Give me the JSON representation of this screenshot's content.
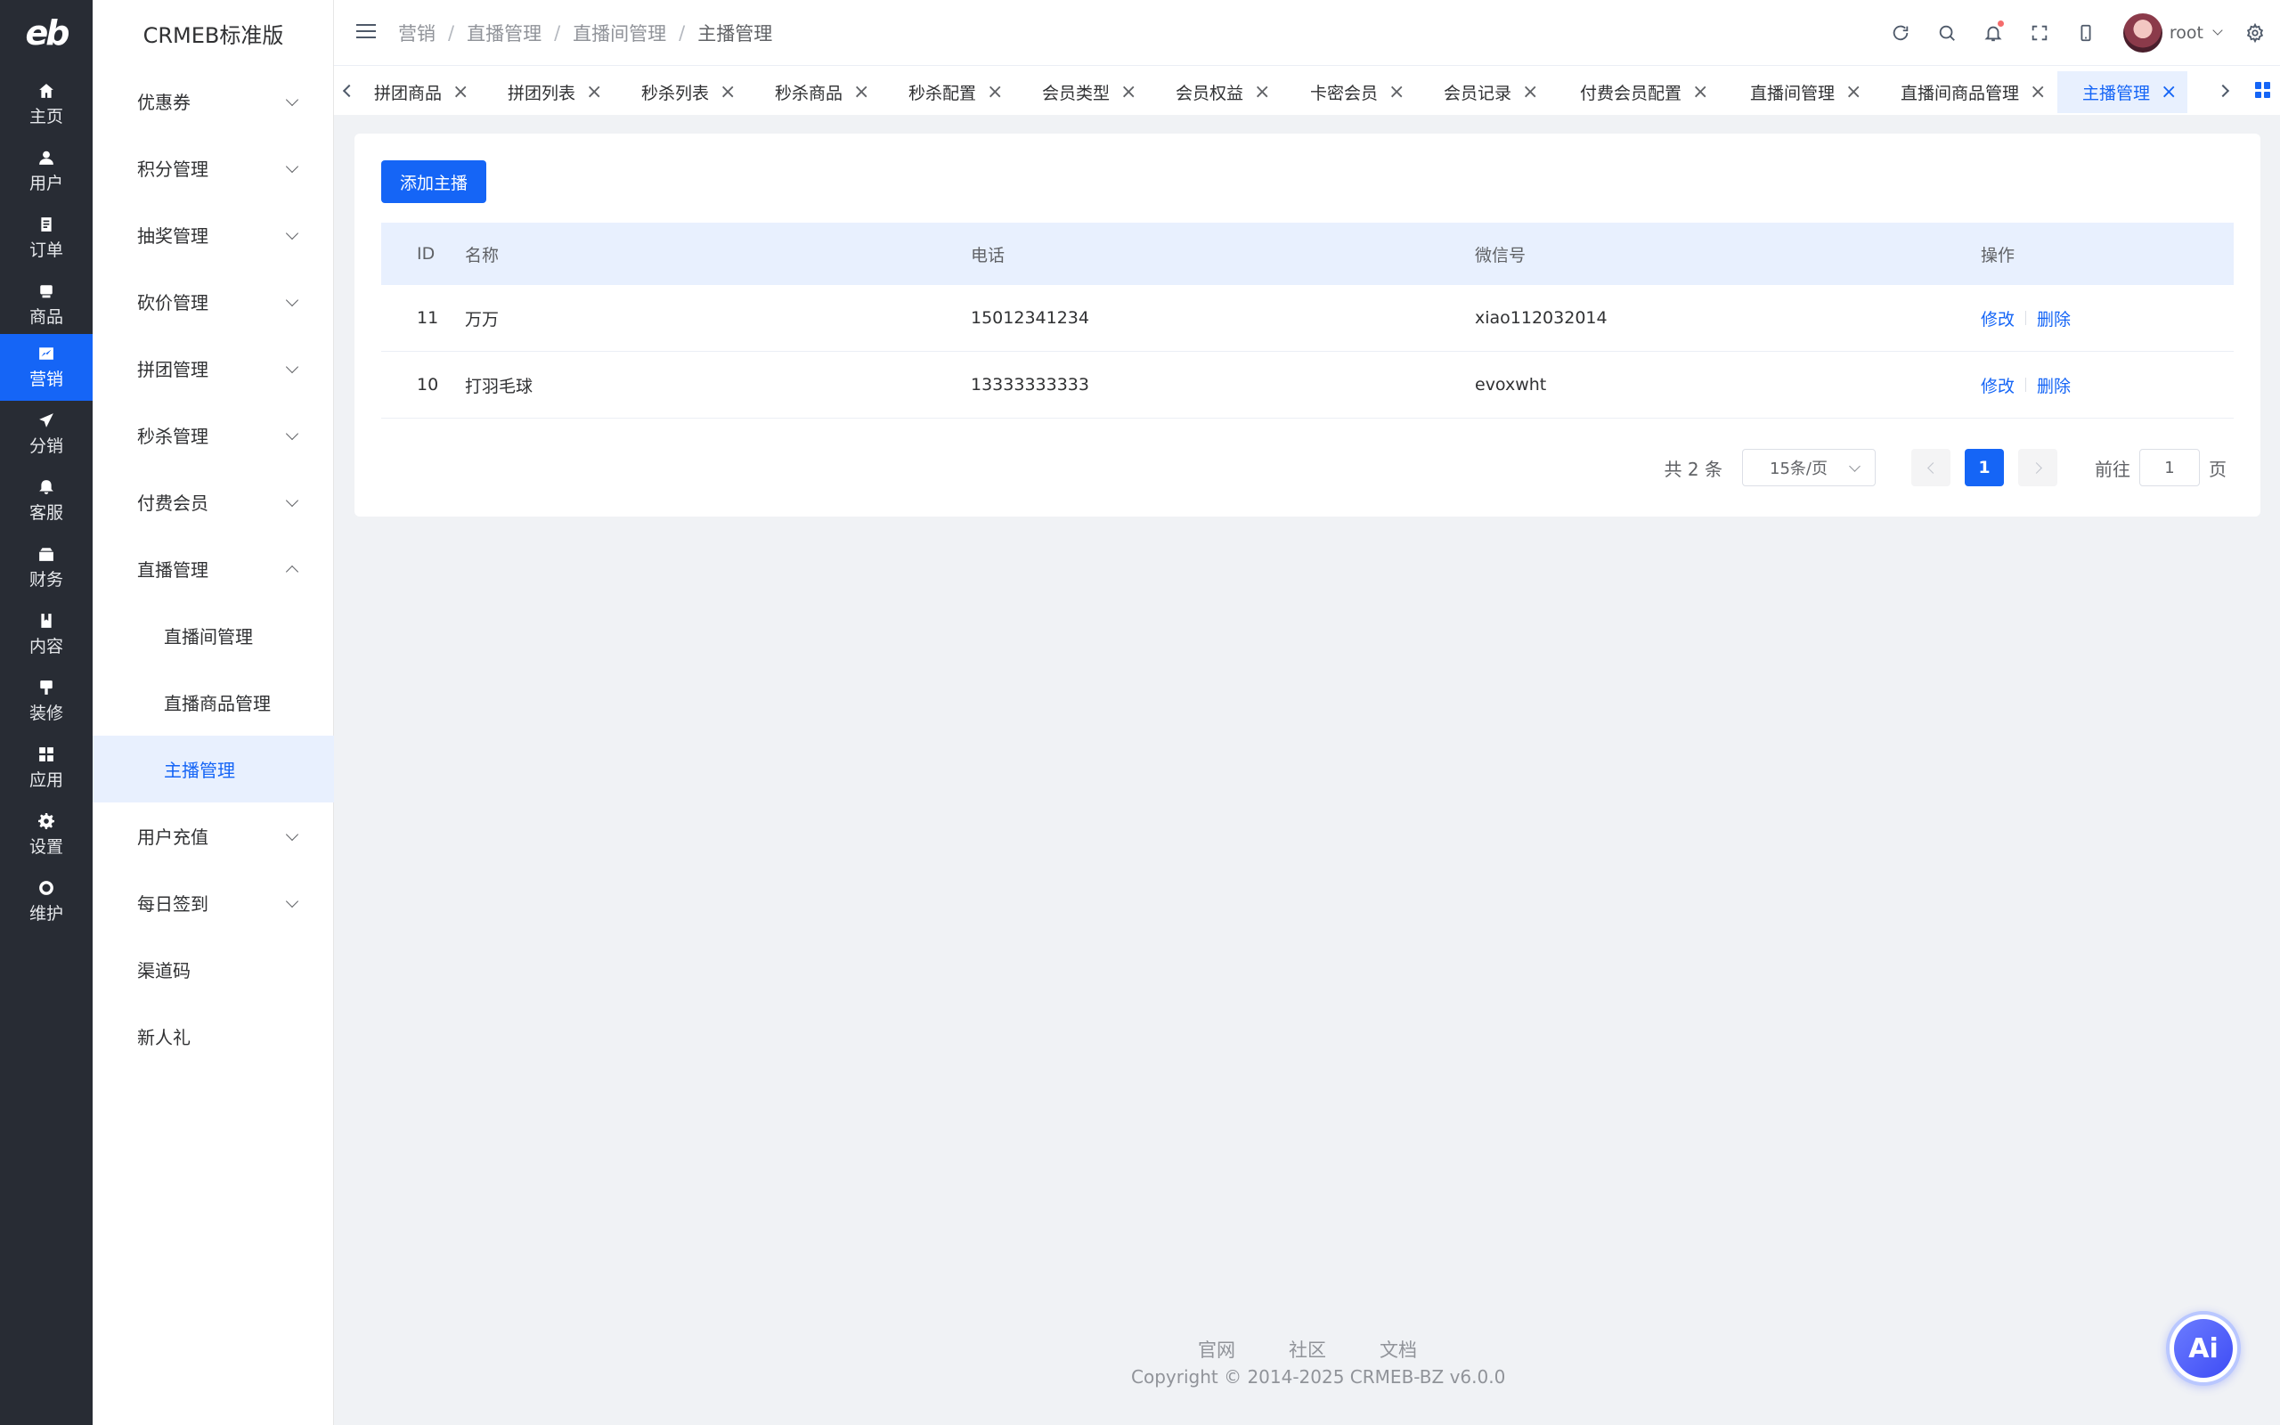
{
  "logo": "eb",
  "rail": [
    {
      "icon": "home-icon",
      "label": "主页"
    },
    {
      "icon": "user-icon",
      "label": "用户"
    },
    {
      "icon": "order-icon",
      "label": "订单"
    },
    {
      "icon": "goods-icon",
      "label": "商品"
    },
    {
      "icon": "marketing-icon",
      "label": "营销",
      "active": true
    },
    {
      "icon": "send-icon",
      "label": "分销"
    },
    {
      "icon": "bell-icon",
      "label": "客服"
    },
    {
      "icon": "finance-icon",
      "label": "财务"
    },
    {
      "icon": "book-icon",
      "label": "内容"
    },
    {
      "icon": "decorate-icon",
      "label": "装修"
    },
    {
      "icon": "apps-icon",
      "label": "应用"
    },
    {
      "icon": "gear-icon",
      "label": "设置"
    },
    {
      "icon": "maintain-icon",
      "label": "维护"
    }
  ],
  "brand": "CRMEB标准版",
  "submenu": {
    "items": [
      {
        "label": "优惠券"
      },
      {
        "label": "积分管理"
      },
      {
        "label": "抽奖管理"
      },
      {
        "label": "砍价管理"
      },
      {
        "label": "拼团管理"
      },
      {
        "label": "秒杀管理"
      },
      {
        "label": "付费会员"
      },
      {
        "label": "直播管理"
      },
      {
        "label": "直播间管理"
      },
      {
        "label": "直播商品管理"
      },
      {
        "label": "主播管理"
      },
      {
        "label": "用户充值"
      },
      {
        "label": "每日签到"
      },
      {
        "label": "渠道码"
      },
      {
        "label": "新人礼"
      }
    ]
  },
  "breadcrumb": [
    "营销",
    "直播管理",
    "直播间管理",
    "主播管理"
  ],
  "breadcrumb_sep": "/",
  "user": {
    "name": "root"
  },
  "tabs": [
    {
      "label": "拼团商品"
    },
    {
      "label": "拼团列表"
    },
    {
      "label": "秒杀列表"
    },
    {
      "label": "秒杀商品"
    },
    {
      "label": "秒杀配置"
    },
    {
      "label": "会员类型"
    },
    {
      "label": "会员权益"
    },
    {
      "label": "卡密会员"
    },
    {
      "label": "会员记录"
    },
    {
      "label": "付费会员配置"
    },
    {
      "label": "直播间管理"
    },
    {
      "label": "直播间商品管理"
    },
    {
      "label": "主播管理",
      "active": true
    }
  ],
  "tab_close": "×",
  "content": {
    "add_button": "添加主播",
    "columns": [
      "ID",
      "名称",
      "电话",
      "微信号",
      "操作"
    ],
    "rows": [
      {
        "id": "11",
        "name": "万万",
        "phone": "15012341234",
        "wechat": "xiao112032014"
      },
      {
        "id": "10",
        "name": "打羽毛球",
        "phone": "13333333333",
        "wechat": "evoxwht"
      }
    ],
    "edit_label": "修改",
    "delete_label": "删除"
  },
  "pagination": {
    "total": "共 2 条",
    "page_size": "15条/页",
    "current_page": "1",
    "goto_label": "前往",
    "goto_value": "1",
    "page_suffix": "页"
  },
  "footer": {
    "links": [
      "官网",
      "社区",
      "文档"
    ],
    "copyright": "Copyright © 2014-2025 CRMEB-BZ v6.0.0"
  },
  "ai_label": "Ai",
  "colors": {
    "accent": "#1565f6",
    "rail_bg": "#282c34",
    "active_bg": "#e8f0fe"
  }
}
